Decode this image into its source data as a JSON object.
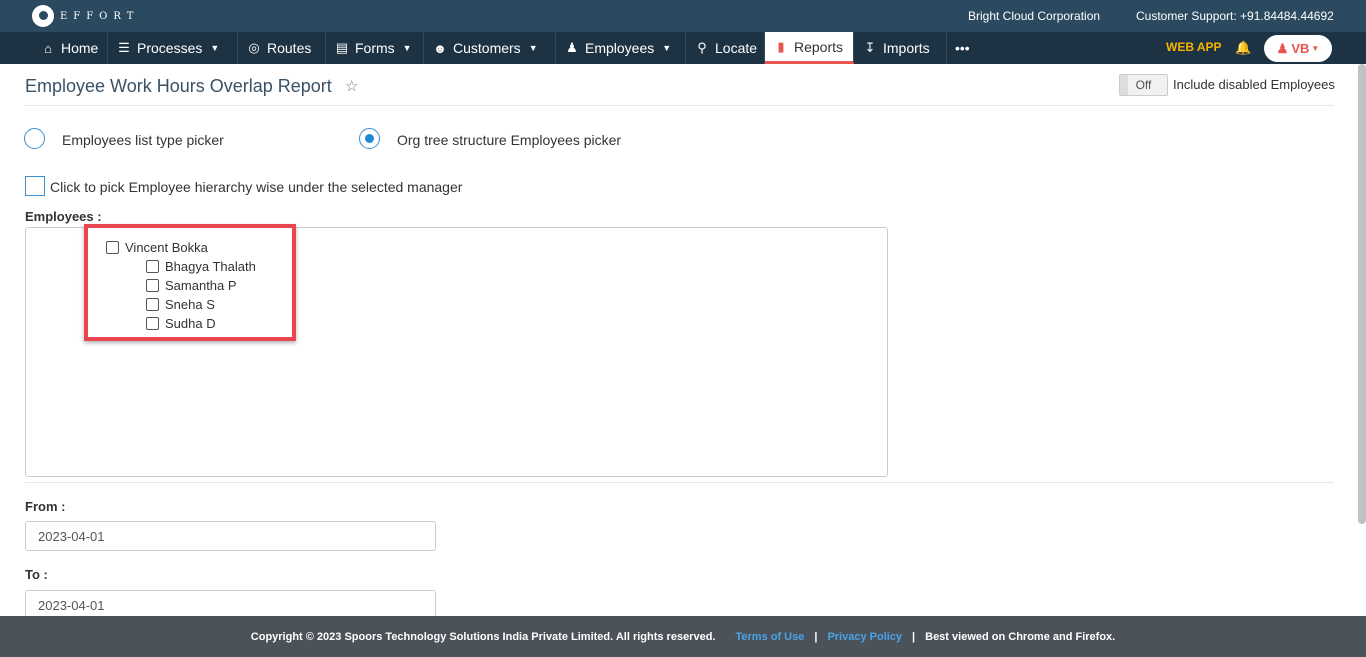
{
  "brand": {
    "logo_text": "EFFORT",
    "company": "Bright Cloud Corporation",
    "support": "Customer Support: +91.84484.44692"
  },
  "nav": {
    "items": [
      {
        "label": "Home",
        "icon": "home-icon"
      },
      {
        "label": "Processes",
        "icon": "processes-icon"
      },
      {
        "label": "Routes",
        "icon": "routes-icon"
      },
      {
        "label": "Forms",
        "icon": "forms-icon"
      },
      {
        "label": "Customers",
        "icon": "customers-icon"
      },
      {
        "label": "Employees",
        "icon": "employees-icon"
      },
      {
        "label": "Locate",
        "icon": "locate-icon"
      },
      {
        "label": "Reports",
        "icon": "reports-icon"
      },
      {
        "label": "Imports",
        "icon": "imports-icon"
      },
      {
        "label": "•••",
        "icon": "more-icon"
      }
    ],
    "active": "Reports",
    "web_app": "WEB APP",
    "user_initials": "VB"
  },
  "page": {
    "title": "Employee Work Hours Overlap Report",
    "toggle_state": "Off",
    "toggle_label": "Include disabled Employees",
    "picker_list": "Employees list type picker",
    "picker_tree": "Org tree structure Employees picker",
    "selected_picker": "tree",
    "hierarchy_checkbox": "Click to pick Employee hierarchy wise under the selected manager",
    "employees_label": "Employees :",
    "tree": {
      "manager": "Vincent Bokka",
      "reports": [
        "Bhagya Thalath",
        "Samantha P",
        "Sneha S",
        "Sudha D"
      ]
    },
    "from_label": "From :",
    "from_value": "2023-04-01",
    "to_label": "To :",
    "to_value": "2023-04-01"
  },
  "footer": {
    "copyright": "Copyright © 2023 Spoors Technology Solutions India Private Limited. All rights reserved.",
    "terms": "Terms of Use",
    "privacy": "Privacy Policy",
    "best_viewed": "Best viewed on Chrome and Firefox.",
    "separator": "|"
  },
  "colors": {
    "topbar": "#2b4a5f",
    "navbar": "#1d3344",
    "accent": "#e8554e",
    "highlight": "#e8454f",
    "link": "#4aa3e8"
  }
}
